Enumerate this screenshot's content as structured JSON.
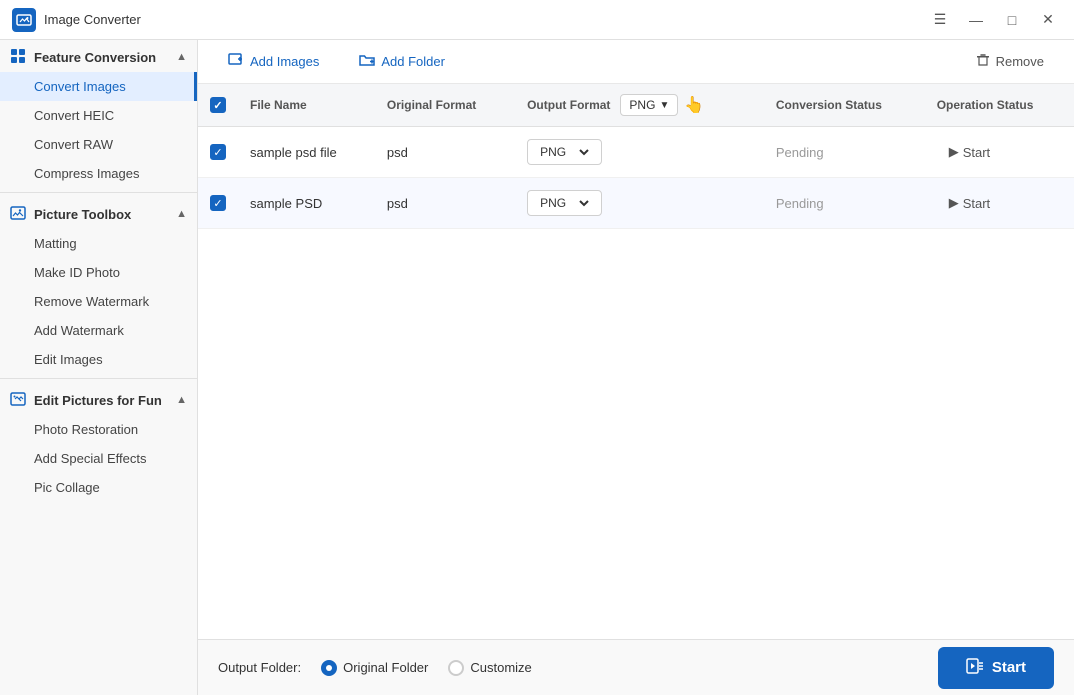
{
  "app": {
    "title": "Image Converter",
    "icon": "🖼"
  },
  "titlebar_controls": {
    "minimize": "—",
    "maximize": "□",
    "close": "✕",
    "menu": "☰"
  },
  "sidebar": {
    "sections": [
      {
        "id": "feature-conversion",
        "label": "Feature Conversion",
        "icon": "⚙",
        "expanded": true,
        "items": [
          {
            "id": "convert-images",
            "label": "Convert Images",
            "active": true
          },
          {
            "id": "convert-heic",
            "label": "Convert HEIC",
            "active": false
          },
          {
            "id": "convert-raw",
            "label": "Convert RAW",
            "active": false
          },
          {
            "id": "compress-images",
            "label": "Compress Images",
            "active": false
          }
        ]
      },
      {
        "id": "picture-toolbox",
        "label": "Picture Toolbox",
        "icon": "🖼",
        "expanded": true,
        "items": [
          {
            "id": "matting",
            "label": "Matting",
            "active": false
          },
          {
            "id": "make-id-photo",
            "label": "Make ID Photo",
            "active": false
          },
          {
            "id": "remove-watermark",
            "label": "Remove Watermark",
            "active": false
          },
          {
            "id": "add-watermark",
            "label": "Add Watermark",
            "active": false
          },
          {
            "id": "edit-images",
            "label": "Edit Images",
            "active": false
          }
        ]
      },
      {
        "id": "edit-pictures-for-fun",
        "label": "Edit Pictures for Fun",
        "icon": "✨",
        "expanded": true,
        "items": [
          {
            "id": "photo-restoration",
            "label": "Photo Restoration",
            "active": false
          },
          {
            "id": "add-special-effects",
            "label": "Add Special Effects",
            "active": false
          },
          {
            "id": "pic-collage",
            "label": "Pic Collage",
            "active": false
          }
        ]
      }
    ]
  },
  "toolbar": {
    "add_images_label": "Add Images",
    "add_folder_label": "Add Folder",
    "remove_label": "Remove"
  },
  "table": {
    "columns": {
      "file_name": "File Name",
      "original_format": "Original Format",
      "output_format": "Output Format",
      "output_format_value": "PNG",
      "conversion_status": "Conversion Status",
      "operation_status": "Operation Status"
    },
    "rows": [
      {
        "checked": true,
        "file_name": "sample psd file",
        "original_format": "psd",
        "output_format": "PNG",
        "conversion_status": "Pending",
        "operation_status": "Start"
      },
      {
        "checked": true,
        "file_name": "sample PSD",
        "original_format": "psd",
        "output_format": "PNG",
        "conversion_status": "Pending",
        "operation_status": "Start"
      }
    ]
  },
  "bottom_bar": {
    "output_folder_label": "Output Folder:",
    "original_folder_label": "Original Folder",
    "customize_label": "Customize",
    "start_label": "Start"
  }
}
